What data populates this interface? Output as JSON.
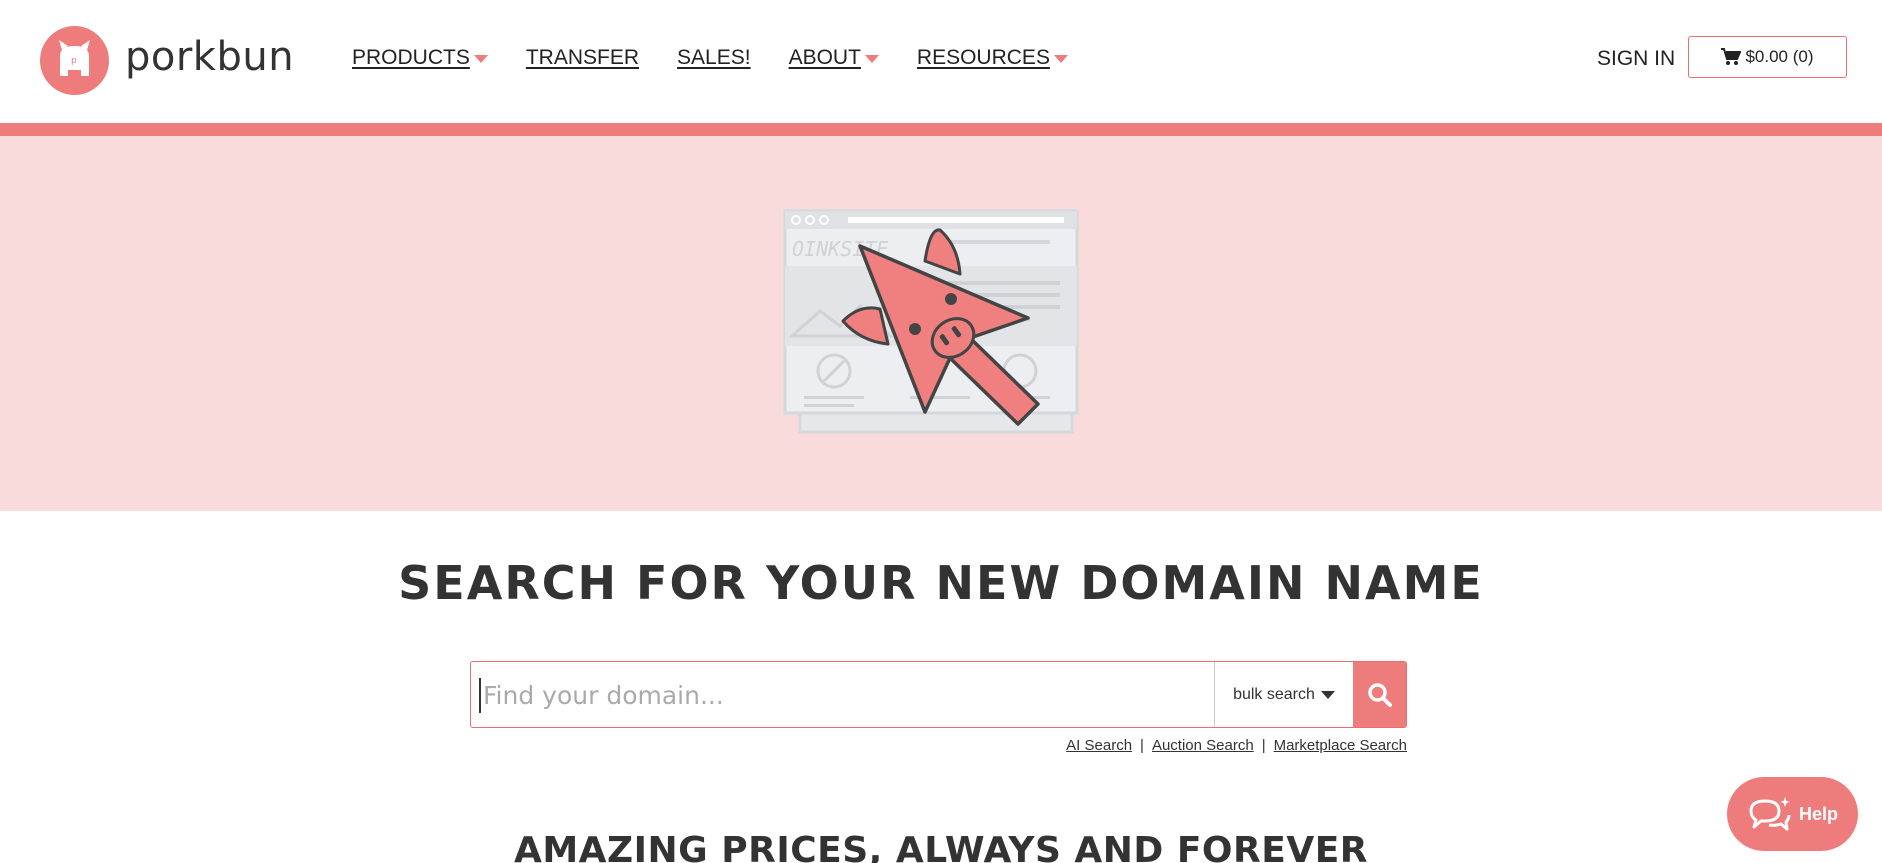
{
  "brand": {
    "name": "porkbun",
    "accent": "#ef7c7c",
    "hero_bg": "#f9dbdb"
  },
  "nav": {
    "items": [
      {
        "label": "PRODUCTS",
        "dropdown": true
      },
      {
        "label": "TRANSFER",
        "dropdown": false
      },
      {
        "label": "SALES!",
        "dropdown": false
      },
      {
        "label": "ABOUT",
        "dropdown": true
      },
      {
        "label": "RESOURCES",
        "dropdown": true
      }
    ],
    "signin": "SIGN IN",
    "cart": {
      "icon": "cart-icon",
      "label": "$0.00 (0)"
    }
  },
  "hero": {
    "illustration_text": "OINKSITE"
  },
  "search": {
    "title": "SEARCH FOR YOUR NEW DOMAIN NAME",
    "placeholder": "Find your domain...",
    "value": "",
    "bulk_label": "bulk search",
    "button_icon": "search-icon",
    "links": [
      "AI Search",
      "Auction Search",
      "Marketplace Search"
    ]
  },
  "tagline": "AMAZING PRICES, ALWAYS AND FOREVER",
  "help": {
    "label": "Help",
    "icon": "chat-bubbles-icon"
  }
}
